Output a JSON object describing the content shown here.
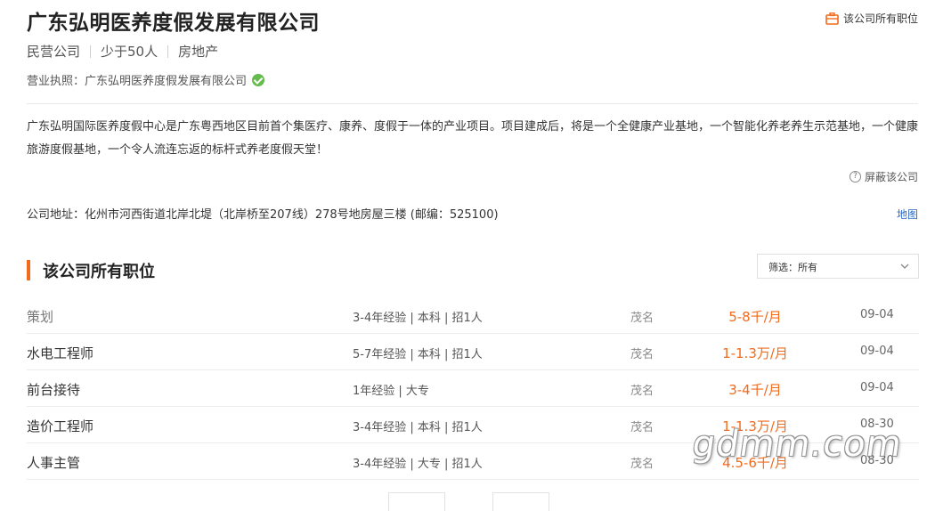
{
  "company": {
    "name": "广东弘明医养度假发展有限公司",
    "type": "民营公司",
    "size": "少于50人",
    "industry": "房地产",
    "license_label": "营业执照：",
    "license_name": "广东弘明医养度假发展有限公司",
    "description": "广东弘明国际医养度假中心是广东粤西地区目前首个集医疗、康养、度假于一体的产业项目。项目建成后，将是一个全健康产业基地，一个智能化养老养生示范基地，一个健康旅游度假基地，一个令人流连忘返的标杆式养老度假天堂！",
    "address_label": "公司地址：",
    "address": "化州市河西街道北岸北堤（北岸桥至207线）278号地房屋三楼 (邮编：525100)"
  },
  "header": {
    "all_jobs_link": "该公司所有职位",
    "block_link": "屏蔽该公司",
    "map_link": "地图",
    "accent_color": "#f26b1d"
  },
  "jobs_section": {
    "title": "该公司所有职位",
    "filter_label": "筛选：",
    "filter_value": "所有"
  },
  "jobs": [
    {
      "title": "策划",
      "requirements": "3-4年经验 | 本科 | 招1人",
      "location": "茂名",
      "salary": "5-8千/月",
      "date": "09-04"
    },
    {
      "title": "水电工程师",
      "requirements": "5-7年经验 | 本科 | 招1人",
      "location": "茂名",
      "salary": "1-1.3万/月",
      "date": "09-04"
    },
    {
      "title": "前台接待",
      "requirements": "1年经验 | 大专",
      "location": "茂名",
      "salary": "3-4千/月",
      "date": "09-04"
    },
    {
      "title": "造价工程师",
      "requirements": "3-4年经验 | 本科 | 招1人",
      "location": "茂名",
      "salary": "1-1.3万/月",
      "date": "08-30"
    },
    {
      "title": "人事主管",
      "requirements": "3-4年经验 | 大专 | 招1人",
      "location": "茂名",
      "salary": "4.5-6千/月",
      "date": "08-30"
    }
  ],
  "watermark": "gdmm.com"
}
